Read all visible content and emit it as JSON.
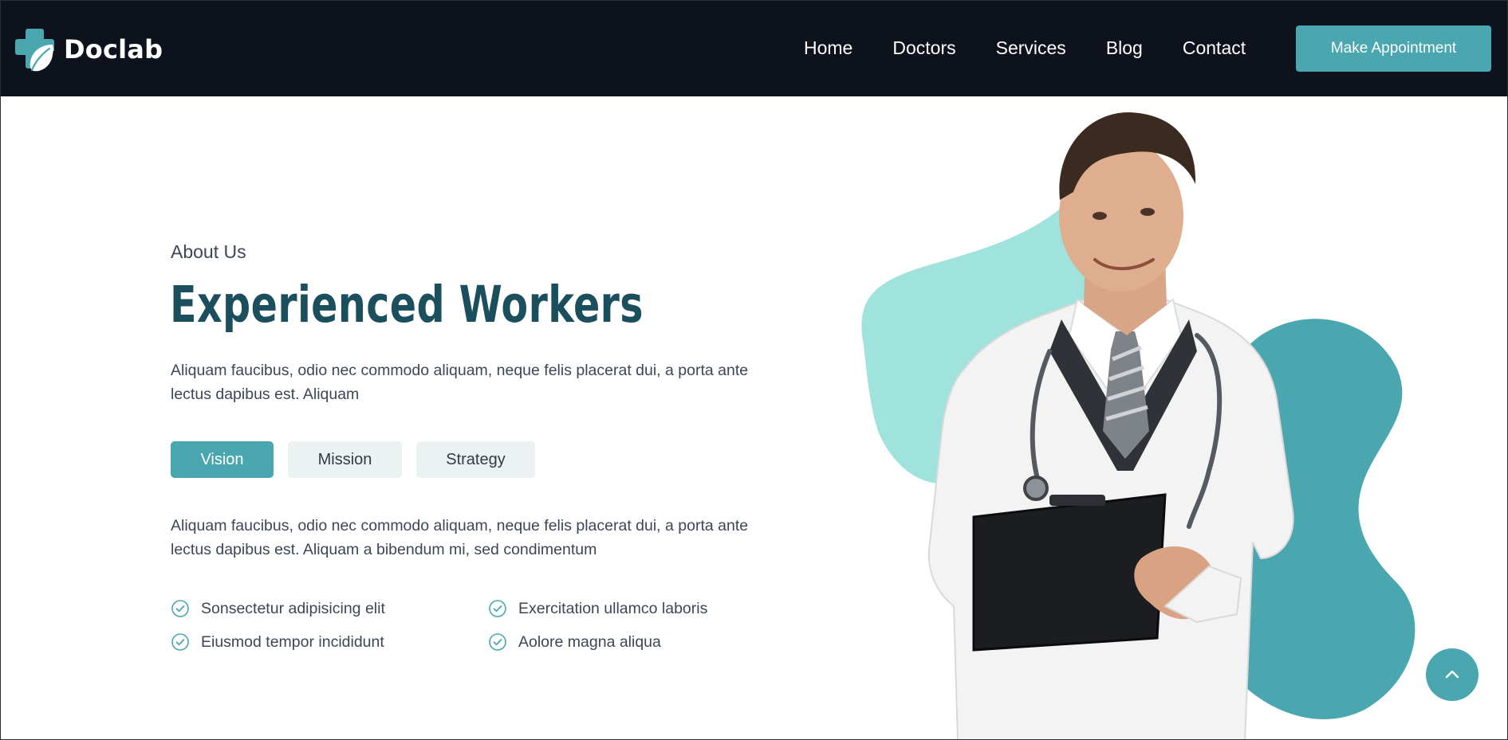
{
  "brand": {
    "name": "Doclab",
    "logo_icon": "cross-leaf-logo"
  },
  "nav": {
    "items": [
      "Home",
      "Doctors",
      "Services",
      "Blog",
      "Contact"
    ],
    "cta_label": "Make Appointment"
  },
  "about": {
    "eyebrow": "About Us",
    "title": "Experienced Workers",
    "intro": "Aliquam faucibus, odio nec commodo aliquam, neque felis placerat dui, a porta ante lectus dapibus est. Aliquam",
    "tabs": [
      {
        "label": "Vision",
        "active": true
      },
      {
        "label": "Mission",
        "active": false
      },
      {
        "label": "Strategy",
        "active": false
      }
    ],
    "body": "Aliquam faucibus, odio nec commodo aliquam, neque felis placerat dui, a porta ante lectus dapibus est. Aliquam a bibendum mi, sed condimentum",
    "features": [
      "Sonsectetur adipisicing elit",
      "Exercitation ullamco laboris",
      "Eiusmod tempor incididunt",
      "Aolore magna aliqua"
    ]
  },
  "colors": {
    "header_bg": "#0d121c",
    "accent": "#4aa7b0",
    "accent_light": "#9fe3dc",
    "title": "#1c4f5d",
    "text": "#3c4656"
  },
  "icons": {
    "feature": "check-circle-icon",
    "scroll_top": "chevron-up-icon"
  }
}
